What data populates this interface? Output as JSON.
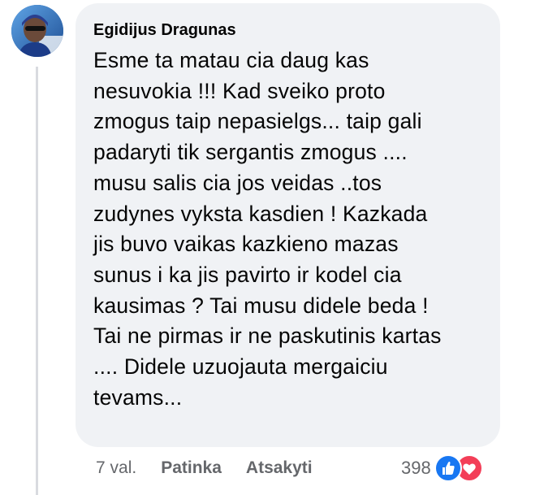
{
  "comment": {
    "author": "Egidijus Dragunas",
    "text": "Esme ta matau cia daug kas\nnesuvokia !!! Kad sveiko proto\nzmogus taip nepasielgs... taip gali\npadaryti tik sergantis zmogus ....\nmusu salis cia jos veidas ..tos\nzudynes vyksta kasdien ! Kazkada\njis buvo vaikas kazkieno mazas\nsunus i ka jis pavirto ir kodel cia\nkausimas ? Tai musu didele beda !\nTai ne pirmas ir ne paskutinis kartas\n.... Didele uzuojauta mergaiciu\ntevams...",
    "time": "7 val.",
    "like_label": "Patinka",
    "reply_label": "Atsakyti",
    "reaction_count": "398",
    "reactions": [
      "like-icon",
      "love-icon"
    ]
  },
  "colors": {
    "bubble_bg": "#f0f2f5",
    "meta_text": "#65676b",
    "like_blue": "#1877f2",
    "love_red": "#f33e58"
  }
}
